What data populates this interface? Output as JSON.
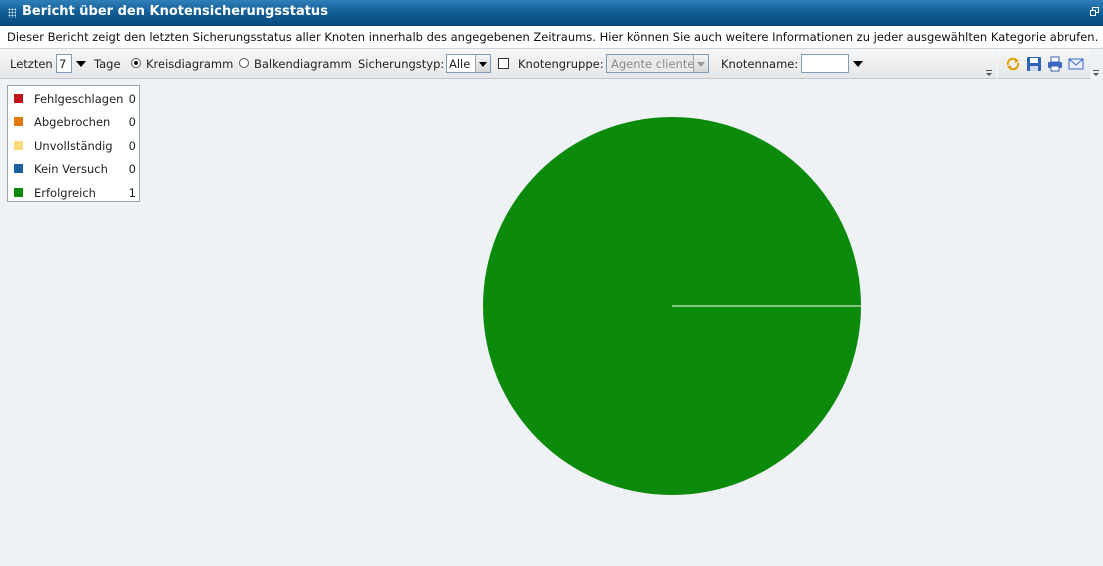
{
  "window": {
    "title": "Bericht über den Knotensicherungsstatus",
    "description": "Dieser Bericht zeigt den letzten Sicherungsstatus aller Knoten innerhalb des angegebenen Zeitraums. Hier können Sie auch weitere Informationen zu jeder ausgewählten Kategorie abrufen."
  },
  "toolbar": {
    "last_label": "Letzten",
    "days_value": "7",
    "days_label": "Tage",
    "pie_label": "Kreisdiagramm",
    "bar_label": "Balkendiagramm",
    "chart_mode": "pie",
    "backup_type_label": "Sicherungstyp:",
    "backup_type_value": "Alle",
    "node_group_checked": false,
    "node_group_label": "Knotengruppe:",
    "node_group_value": "Agente cliente",
    "node_name_label": "Knotenname:",
    "node_name_value": ""
  },
  "actions": [
    "refresh-icon",
    "save-icon",
    "print-icon",
    "email-icon"
  ],
  "chart_data": {
    "type": "pie",
    "categories": [
      "Fehlgeschlagen",
      "Abgebrochen",
      "Unvollständig",
      "Kein Versuch",
      "Erfolgreich"
    ],
    "values": [
      0,
      0,
      0,
      0,
      1
    ],
    "colors": [
      "#c0141a",
      "#e07a10",
      "#ffd97a",
      "#1a5fa0",
      "#0c8a0c"
    ],
    "legend_position": "top-left"
  },
  "legend": {
    "items": [
      {
        "label": "Fehlgeschlagen",
        "value": "0"
      },
      {
        "label": "Abgebrochen",
        "value": "0"
      },
      {
        "label": "Unvollständig",
        "value": "0"
      },
      {
        "label": "Kein Versuch",
        "value": "0"
      },
      {
        "label": "Erfolgreich",
        "value": "1"
      }
    ]
  }
}
